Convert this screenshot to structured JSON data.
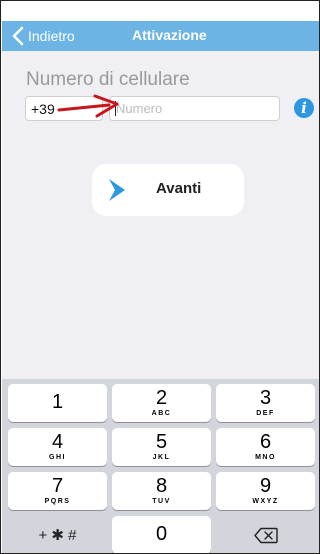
{
  "navbar": {
    "back_label": "Indietro",
    "title": "Attivazione"
  },
  "form": {
    "label": "Numero di cellulare",
    "country_code": "+39",
    "number_placeholder": "Numero",
    "number_value": "",
    "info_icon": "info-icon"
  },
  "next_button": {
    "label": "Avanti",
    "icon": "chevron-right-icon"
  },
  "keypad": {
    "keys": [
      {
        "digit": "1",
        "letters": ""
      },
      {
        "digit": "2",
        "letters": "ABC"
      },
      {
        "digit": "3",
        "letters": "DEF"
      },
      {
        "digit": "4",
        "letters": "GHI"
      },
      {
        "digit": "5",
        "letters": "JKL"
      },
      {
        "digit": "6",
        "letters": "MNO"
      },
      {
        "digit": "7",
        "letters": "PQRS"
      },
      {
        "digit": "8",
        "letters": "TUV"
      },
      {
        "digit": "9",
        "letters": "WXYZ"
      }
    ],
    "symbols_label": "+ ✱ #",
    "zero": "0",
    "delete_icon": "backspace-icon"
  },
  "colors": {
    "navbar": "#6bb4e3",
    "accent": "#2d97e0",
    "annotation_arrow": "#c8161c"
  }
}
